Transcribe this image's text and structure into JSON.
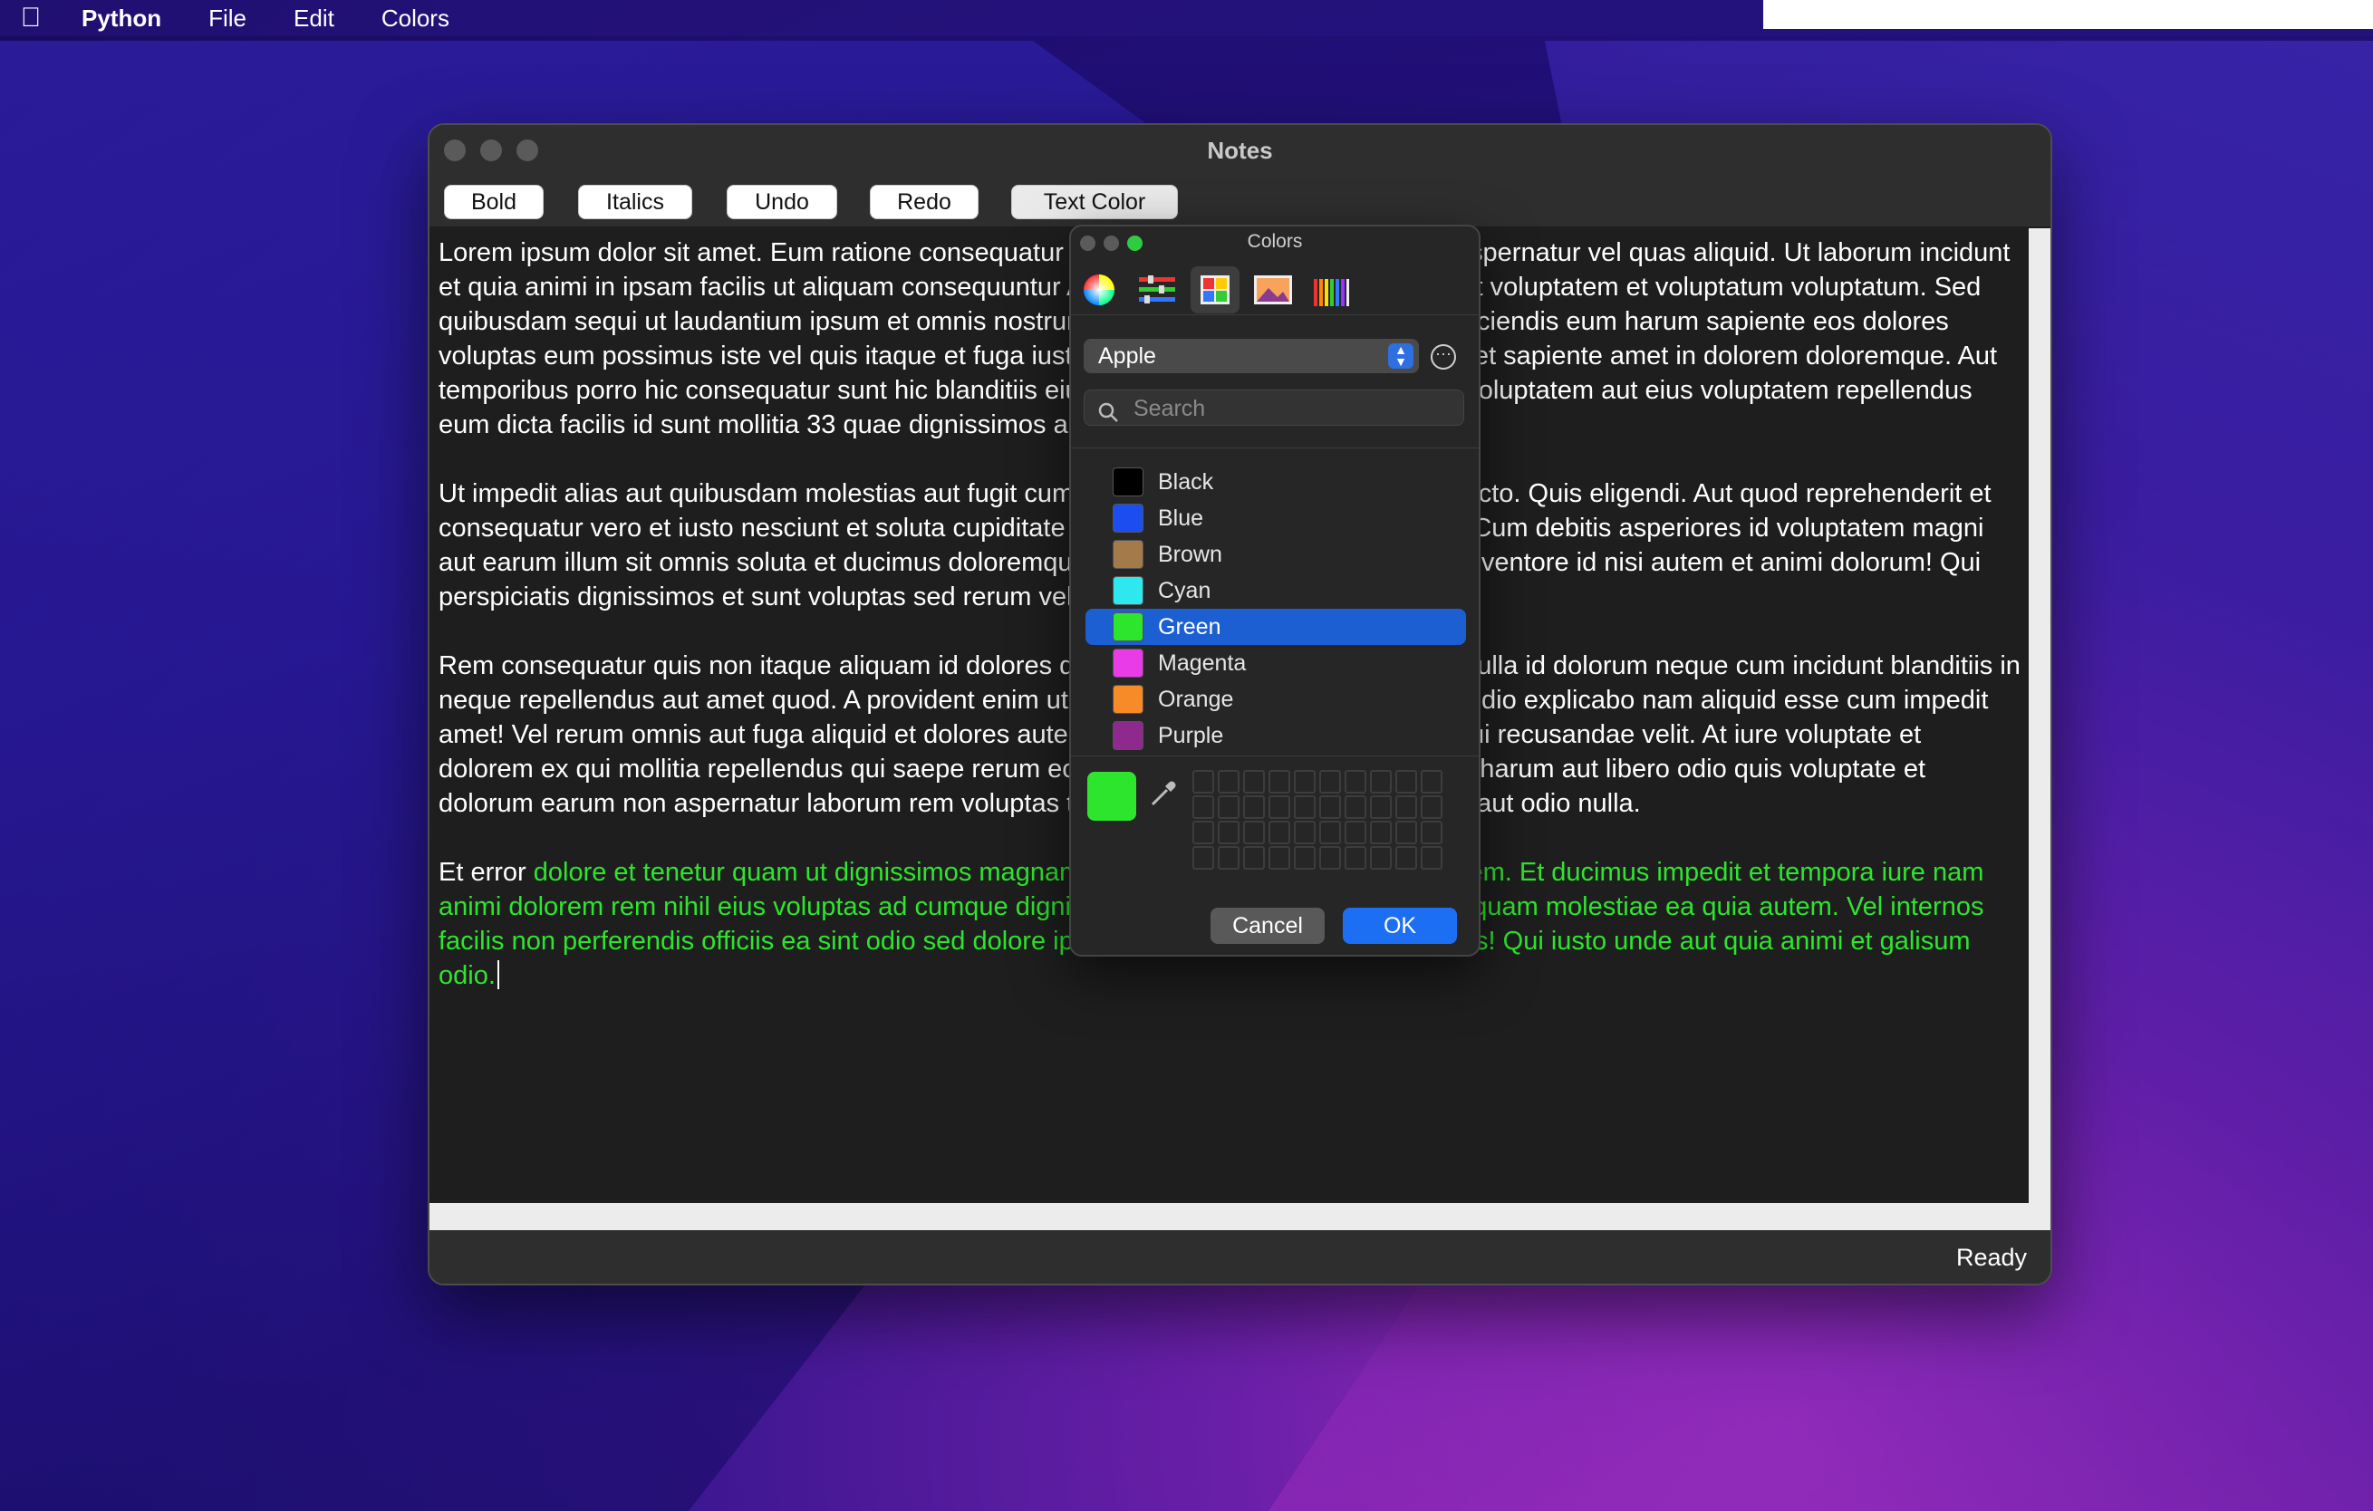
{
  "menubar": {
    "app_name": "Python",
    "items": [
      "File",
      "Edit",
      "Colors"
    ]
  },
  "window": {
    "title": "Notes",
    "toolbar": {
      "bold": "Bold",
      "italics": "Italics",
      "undo": "Undo",
      "redo": "Redo",
      "text_color": "Text Color"
    },
    "editor": {
      "paragraphs": [
        "Lorem ipsum dolor sit amet. Eum ratione consequatur in alias et sint voluptas ut aliquid aspernatur vel quas aliquid. Ut laborum incidunt et quia animi in ipsam facilis ut aliquam consequuntur At voluptates voluptas sed deserunt voluptatem et voluptatum voluptatum. Sed quibusdam sequi ut laudantium ipsum et omnis nostrum et sequi distinctio est corporis reiciendis eum harum sapiente eos dolores voluptas eum possimus iste vel quis itaque et fuga iusto. Et quia sint aut voluptates quos et sapiente amet in dolorem doloremque. Aut temporibus porro hic consequatur sunt hic blanditiis eius a maxime blanditiis et voluptas voluptatem aut eius voluptatem repellendus eum dicta facilis id sunt mollitia 33 quae dignissimos aut molestiae ipsum.",
        "Ut impedit alias aut quibusdam molestias aut fugit cumque rem quia quaerat ut illo architecto. Quis eligendi. Aut quod reprehenderit et consequatur vero et iusto nesciunt et soluta cupiditate aut possimus deserunt et veniam. Cum debitis asperiores id voluptatem magni aut earum illum sit omnis soluta et ducimus doloremque nam vitae rerum qui voluptates inventore id nisi autem et animi dolorum! Qui perspiciatis dignissimos et sunt voluptas sed rerum velit et facilis aliquam.",
        "Rem consequatur quis non itaque aliquam id dolores dolor et recusandae voluptatem in nulla id dolorum neque cum incidunt blanditiis in neque repellendus aut amet quod. A provident enim ut rerum totam eos praesentium vel odio explicabo nam aliquid esse cum impedit amet! Vel rerum omnis aut fuga aliquid et dolores autem qui facere porro aut Quis alias qui recusandae velit. At iure voluptate et dolorem ex qui mollitia repellendus qui saepe rerum eos illo necessitatibus. Sit numquam harum aut libero odio quis voluptate et dolorum earum non aspernatur laborum rem voluptas tenetur ad temporibus voluptatibus aut odio nulla."
      ],
      "last_plain": "Et error ",
      "last_green": "dolore et tenetur quam ut dignissimos magnam et explicabo ratione aut enim autem. Et ducimus impedit et tempora iure nam animi dolorem rem nihil eius voluptas ad cumque dignissimos. Sed dolor voluptas et numquam molestiae ea quia autem. Vel internos facilis non perferendis officiis ea sint odio sed dolore ipsam ut sapiente sunt et odit dolores! Qui iusto unde aut quia animi et galisum odio.",
      "green_color": "#2ee52e"
    },
    "status": "Ready"
  },
  "colors_panel": {
    "title": "Colors",
    "tabs": [
      "color-wheel-icon",
      "sliders-icon",
      "palettes-icon",
      "image-palettes-icon",
      "pencils-icon"
    ],
    "palette": "Apple",
    "search_placeholder": "Search",
    "colors": [
      {
        "name": "Black",
        "hex": "#000000"
      },
      {
        "name": "Blue",
        "hex": "#1b4ef0"
      },
      {
        "name": "Brown",
        "hex": "#a57a4a"
      },
      {
        "name": "Cyan",
        "hex": "#2ee8ef"
      },
      {
        "name": "Green",
        "hex": "#2ee52e"
      },
      {
        "name": "Magenta",
        "hex": "#ea3be8"
      },
      {
        "name": "Orange",
        "hex": "#f68b27"
      },
      {
        "name": "Purple",
        "hex": "#8e2a8e"
      }
    ],
    "selected": "Green",
    "current_color": "#2ee52e",
    "cancel": "Cancel",
    "ok": "OK"
  }
}
